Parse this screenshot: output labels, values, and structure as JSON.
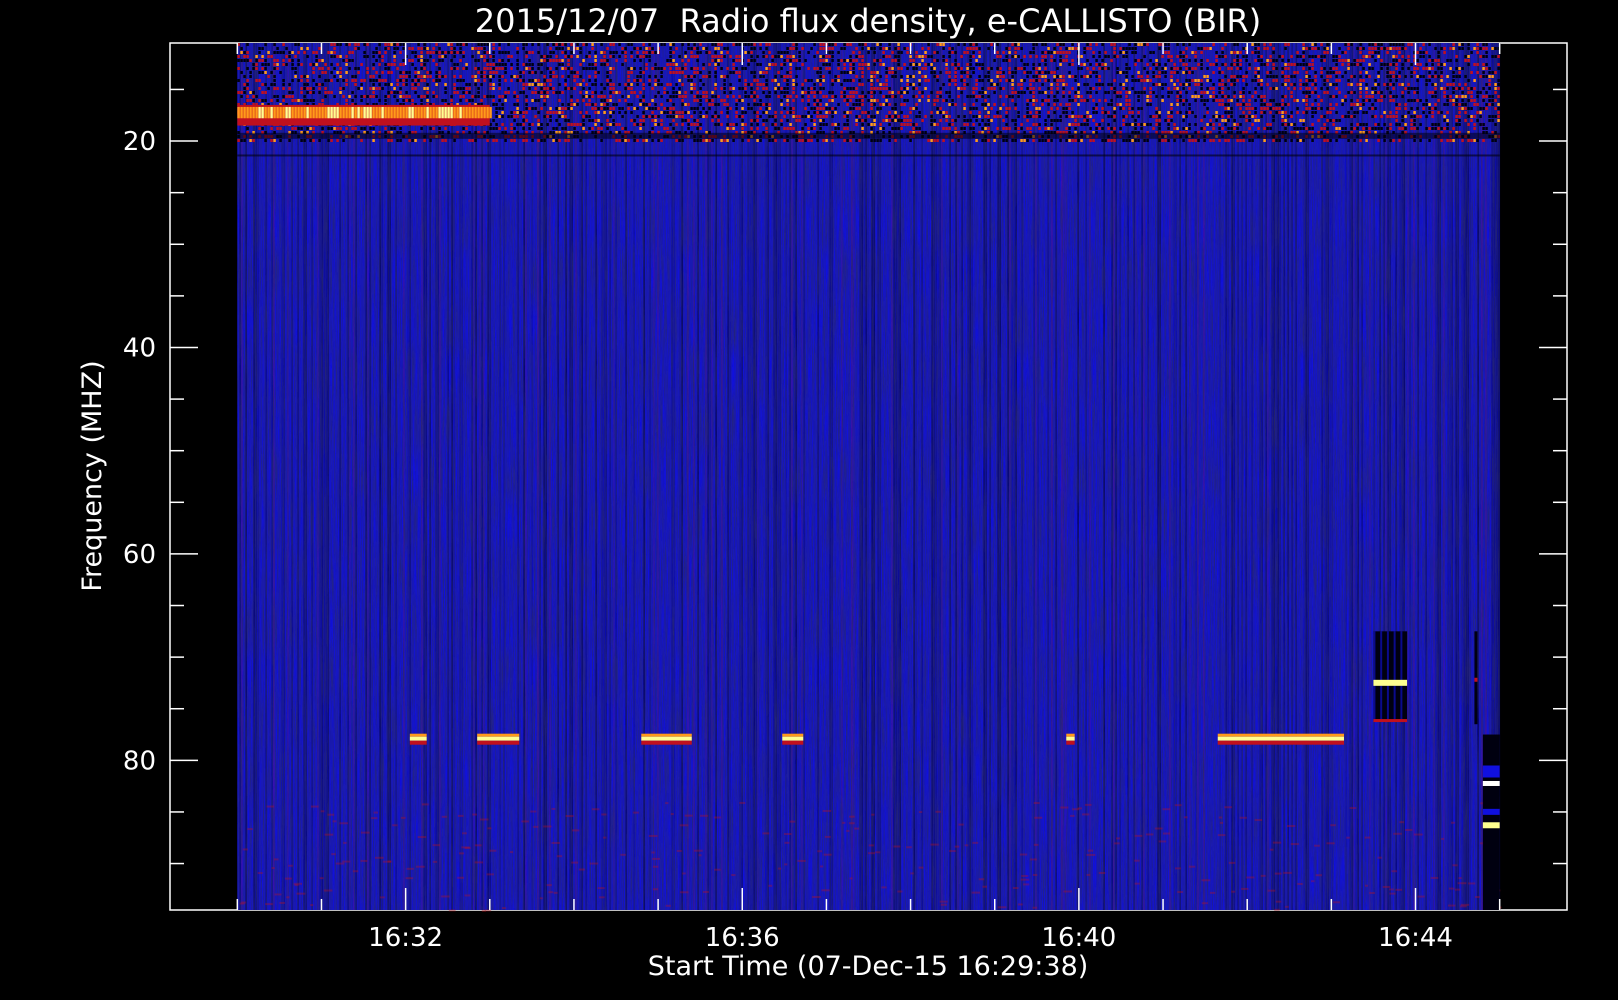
{
  "chart_data": {
    "type": "heatmap",
    "title": "2015/12/07  Radio flux density, e-CALLISTO (BIR)",
    "xlabel": "Start Time (07-Dec-15 16:29:38)",
    "ylabel": "Frequency (MHZ)",
    "x_ticks": [
      "16:32",
      "16:36",
      "16:40",
      "16:44"
    ],
    "x_tick_minutes": [
      32,
      36,
      40,
      44
    ],
    "x_minor_tick_minutes": [
      30,
      31,
      33,
      34,
      35,
      37,
      38,
      39,
      41,
      42,
      43,
      45
    ],
    "y_ticks": [
      "20",
      "40",
      "60",
      "80"
    ],
    "y_tick_values": [
      20,
      40,
      60,
      80
    ],
    "y_minor_tick_values": [
      15,
      25,
      30,
      35,
      45,
      50,
      55,
      65,
      70,
      75,
      85,
      90
    ],
    "xlim_minutes": [
      29.2,
      45.8
    ],
    "data_extent_minutes": [
      30.0,
      45.0
    ],
    "ylim_mhz": [
      94.5,
      10.5
    ],
    "data_extent_mhz": [
      10.5,
      94.5
    ],
    "y_inverted": true,
    "colors": {
      "background": "#1010e0",
      "low": "#000010",
      "mid": "#c0101e",
      "high": "#ff9a1a",
      "peak": "#ffff90"
    },
    "features": [
      {
        "name": "strong emission band",
        "t_start": 30.0,
        "t_end": 33.0,
        "f_low": 16.5,
        "f_high": 18.5,
        "level": "high"
      },
      {
        "name": "noisy emission region",
        "t_start": 30.0,
        "t_end": 45.0,
        "f_low": 10.5,
        "f_high": 20.0,
        "level": "mid"
      },
      {
        "name": "interference",
        "t": 32.15,
        "f": 78.0,
        "duration": 0.2
      },
      {
        "name": "interference",
        "t": 33.1,
        "f": 78.0,
        "duration": 0.5
      },
      {
        "name": "interference",
        "t": 35.1,
        "f": 78.0,
        "duration": 0.6
      },
      {
        "name": "interference",
        "t": 36.6,
        "f": 78.0,
        "duration": 0.25
      },
      {
        "name": "interference",
        "t": 39.9,
        "f": 78.0,
        "duration": 0.1
      },
      {
        "name": "interference",
        "t": 42.4,
        "f": 78.0,
        "duration": 1.5
      },
      {
        "name": "burst block",
        "t": 43.7,
        "f": 72.0,
        "duration": 0.4
      },
      {
        "name": "edge artifact",
        "t": 44.85,
        "f": 82.0,
        "duration": 0.25
      }
    ]
  }
}
